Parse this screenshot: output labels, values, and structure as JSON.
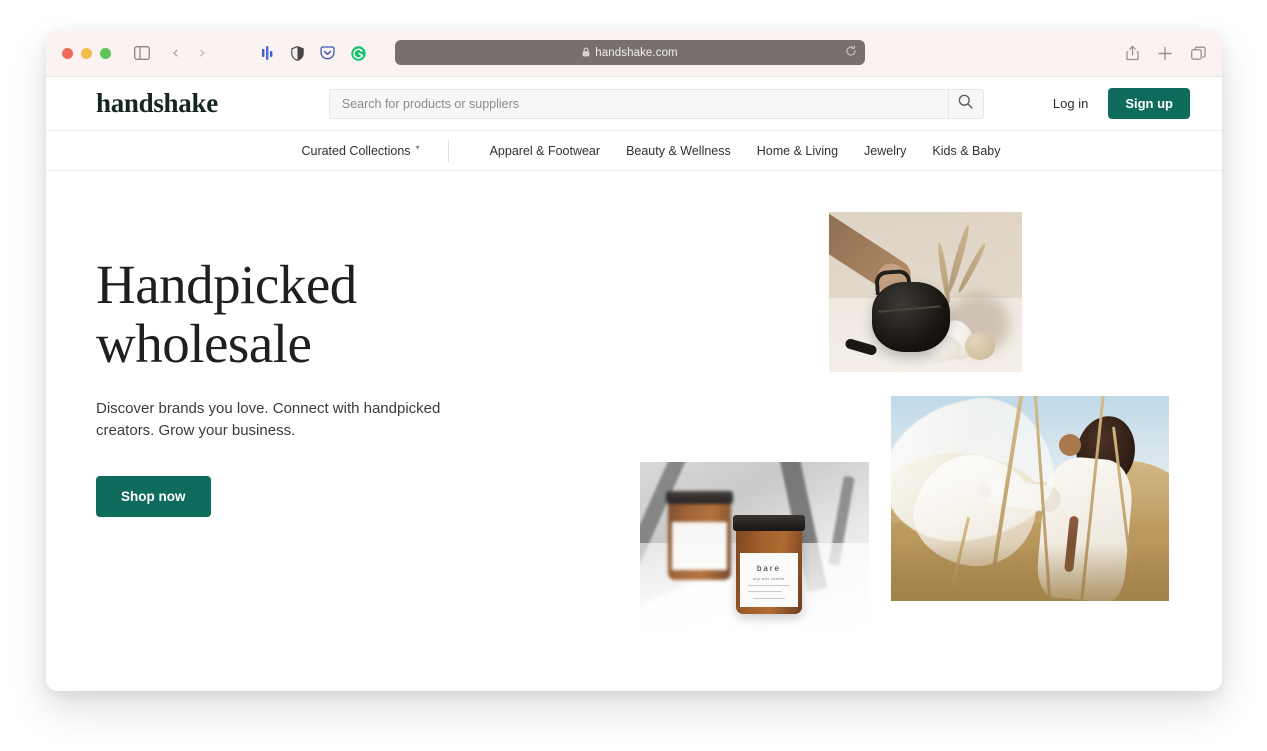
{
  "browser": {
    "traffic_lights": [
      "close",
      "minimize",
      "zoom"
    ],
    "sidebar_icon": "sidebar-icon",
    "back_label": "‹",
    "forward_label": "›",
    "extensions": [
      "bar-chart-icon",
      "shield-icon",
      "pocket-icon",
      "grammarly-icon"
    ],
    "url": {
      "lock": "🔒",
      "text": "handshake.com",
      "reload_icon": "reload-icon"
    },
    "right_icons": [
      "share-icon",
      "new-tab-icon",
      "tab-overview-icon"
    ]
  },
  "site": {
    "logo": "handshake",
    "search": {
      "placeholder": "Search for products or suppliers",
      "value": "",
      "button_icon": "search-icon"
    },
    "login_label": "Log in",
    "signup_label": "Sign up",
    "nav": {
      "curated_label": "Curated Collections",
      "curated_caret": "▾",
      "items": [
        {
          "label": "Apparel & Footwear"
        },
        {
          "label": "Beauty & Wellness"
        },
        {
          "label": "Home & Living"
        },
        {
          "label": "Jewelry"
        },
        {
          "label": "Kids & Baby"
        }
      ]
    },
    "hero": {
      "title_line1": "Handpicked",
      "title_line2": "wholesale",
      "subtitle": "Discover brands you love. Connect with handpicked creators. Grow your business.",
      "cta_label": "Shop now",
      "images": [
        {
          "name": "hero-image-bag",
          "alt": "Hand holding a black leather belt bag beside pampas grass and stones"
        },
        {
          "name": "hero-image-candle-jars",
          "alt": "Two amber candle jars with white bare labels"
        },
        {
          "name": "hero-image-field",
          "alt": "Person in flowing white fabric standing in a golden grass field"
        }
      ],
      "candle_label": {
        "brand": "bare",
        "sub": "soy wax candle"
      }
    },
    "colors": {
      "accent": "#0f6b5c",
      "text": "#1f1f1f",
      "chrome": "#fbf2f2",
      "urlbar": "#78706f"
    }
  }
}
